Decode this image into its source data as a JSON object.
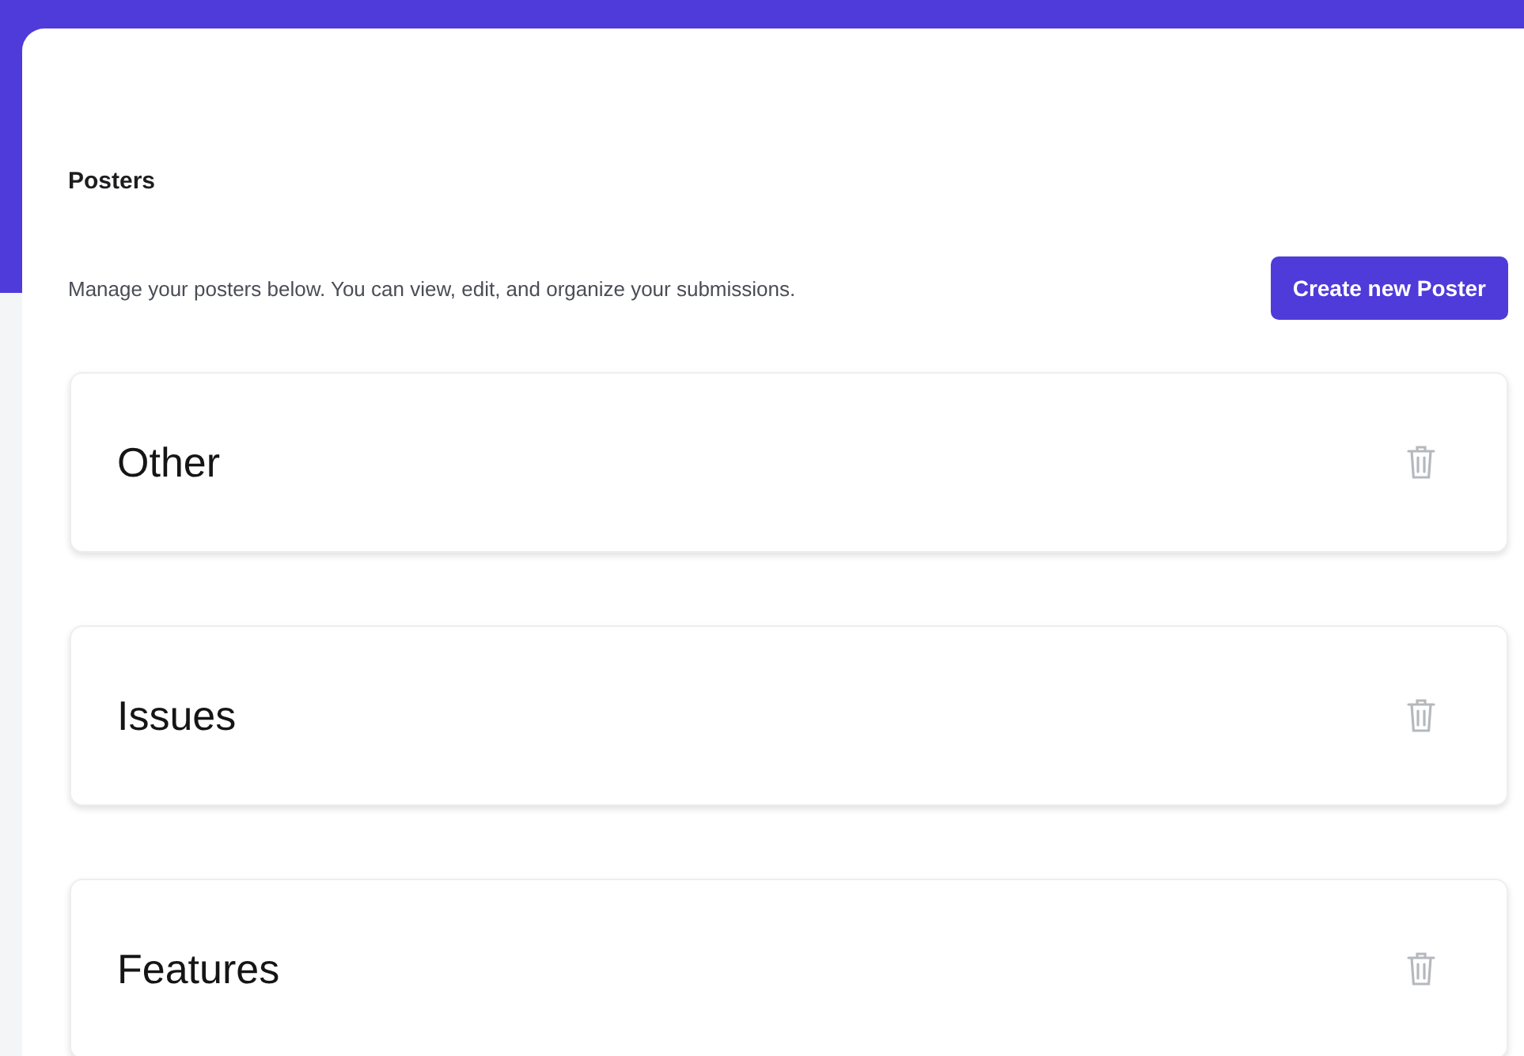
{
  "page": {
    "title": "Posters",
    "description": "Manage your posters below. You can view, edit, and organize your submissions.",
    "create_button": "Create new Poster"
  },
  "posters": [
    {
      "title": "Other"
    },
    {
      "title": "Issues"
    },
    {
      "title": "Features"
    }
  ]
}
